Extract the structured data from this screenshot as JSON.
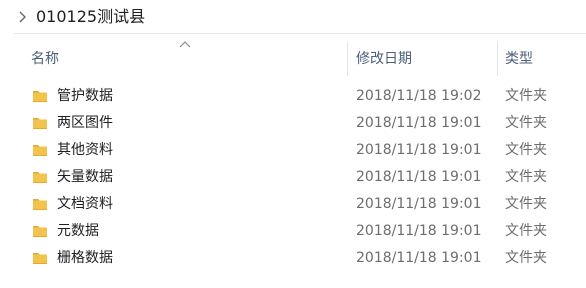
{
  "breadcrumb": {
    "title": "010125测试县",
    "chevron_icon": "chevron-right-icon"
  },
  "columns": {
    "name": "名称",
    "date_modified": "修改日期",
    "type": "类型",
    "sort_icon": "chevron-up-icon"
  },
  "colors": {
    "folder": "#f3c44d",
    "folder_dark": "#e3a92b",
    "header_text": "#4c607a",
    "secondary_text": "#6d6d6d"
  },
  "files": [
    {
      "name": "管护数据",
      "date": "2018/11/18 19:02",
      "type": "文件夹",
      "icon": "folder-icon"
    },
    {
      "name": "两区图件",
      "date": "2018/11/18 19:01",
      "type": "文件夹",
      "icon": "folder-icon"
    },
    {
      "name": "其他资料",
      "date": "2018/11/18 19:01",
      "type": "文件夹",
      "icon": "folder-icon"
    },
    {
      "name": "矢量数据",
      "date": "2018/11/18 19:01",
      "type": "文件夹",
      "icon": "folder-icon"
    },
    {
      "name": "文档资料",
      "date": "2018/11/18 19:01",
      "type": "文件夹",
      "icon": "folder-icon"
    },
    {
      "name": "元数据",
      "date": "2018/11/18 19:01",
      "type": "文件夹",
      "icon": "folder-icon"
    },
    {
      "name": "栅格数据",
      "date": "2018/11/18 19:01",
      "type": "文件夹",
      "icon": "folder-icon"
    }
  ]
}
